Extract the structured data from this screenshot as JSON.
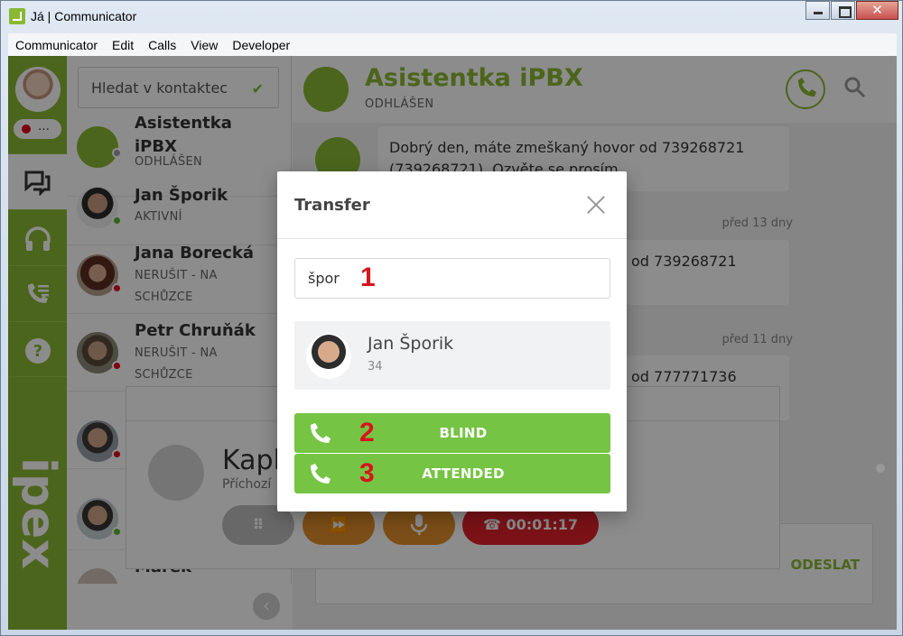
{
  "window": {
    "title": "Já | Communicator"
  },
  "menu": [
    "Communicator",
    "Edit",
    "Calls",
    "View",
    "Developer"
  ],
  "nav": {
    "status_more": "…",
    "items": [
      {
        "icon": "chat-icon",
        "active": true
      },
      {
        "icon": "headset-icon",
        "active": false
      },
      {
        "icon": "call-list-icon",
        "active": false
      },
      {
        "icon": "help-icon",
        "active": false
      }
    ],
    "logo_text": "ipex"
  },
  "contacts": {
    "search_placeholder": "Hledat v kontaktec",
    "list": [
      {
        "name": "Asistentka iPBX",
        "status": "ODHLÁŠEN",
        "dot": "#9e9e9e"
      },
      {
        "name": "Jan Šporik",
        "status": "AKTIVNÍ",
        "dot": "#5cb82e"
      },
      {
        "name": "Jana Borecká",
        "status": "NERUŠIT - NA SCHŮZCE",
        "dot": "#e1001a"
      },
      {
        "name": "Petr Chruňák",
        "status": "NERUŠIT - NA SCHŮZCE",
        "dot": "#e1001a"
      },
      {
        "name": "",
        "status": "",
        "dot": "#e1001a"
      },
      {
        "name": "",
        "status": "",
        "dot": "#5cb82e"
      },
      {
        "name": "Marek",
        "status": "",
        "dot": ""
      }
    ]
  },
  "chat": {
    "name": "Asistentka iPBX",
    "status": "ODHLÁŠEN",
    "messages": [
      {
        "text": "Dobrý den, máte zmeškaný hovor od 739268721 (739268721). Ozvěte se prosím.",
        "time": ""
      },
      {
        "text": "od 739268721",
        "time": "před 13 dny"
      },
      {
        "text": "od 777771736",
        "time": "před 11 dny"
      }
    ],
    "send_label": "ODESLAT"
  },
  "call_panel": {
    "caller": "Kapla",
    "direction": "Příchozí",
    "timer": "00:01:17"
  },
  "dialog": {
    "title": "Transfer",
    "search_value": "špor",
    "result": {
      "name": "Jan Šporik",
      "ext": "34"
    },
    "blind_label": "BLIND",
    "attended_label": "ATTENDED",
    "markers": [
      "1",
      "2",
      "3"
    ]
  },
  "colors": {
    "brand_green": "#8ab833",
    "button_green": "#76c443",
    "hangup_red": "#d8141c",
    "marker_red": "#d8141c"
  }
}
